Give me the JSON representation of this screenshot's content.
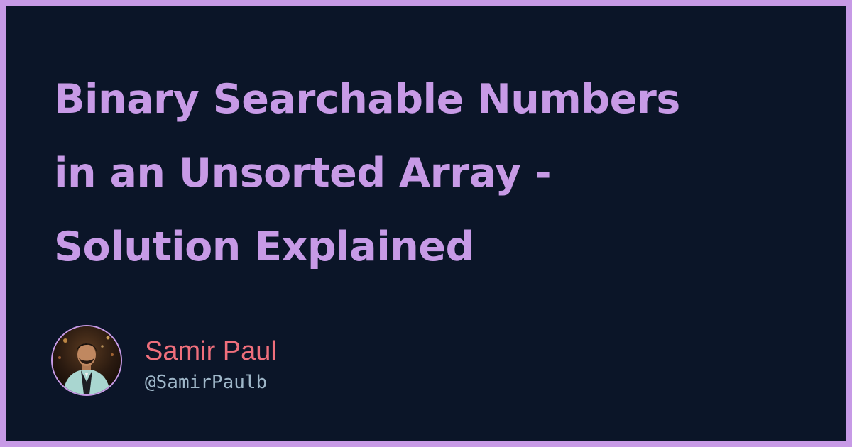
{
  "title": {
    "lines": [
      "Binary Searchable Numbers",
      "in an Unsorted Array -",
      "Solution Explained"
    ]
  },
  "author": {
    "name": "Samir Paul",
    "handle": "@SamirPaulb",
    "avatar_icon": "author-photo"
  },
  "colors": {
    "background": "#0b1528",
    "border": "#c79ae6",
    "title": "#c79ae6",
    "author_name": "#ef6f7c",
    "author_handle": "#9fb7c9"
  }
}
